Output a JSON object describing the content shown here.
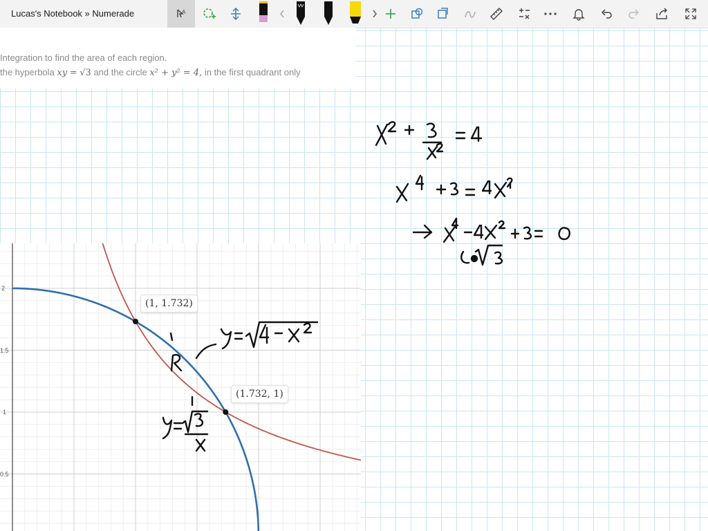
{
  "app": {
    "title": "Lucas's Notebook » Numerade"
  },
  "toolbar": {
    "buttons": [
      "lasso-select",
      "add-shape",
      "insert-space",
      "pen-black-pink",
      "pen-black-1",
      "pen-black-2",
      "pen-black-3",
      "highlighter-yellow",
      "more-pens",
      "add-pen",
      "shapes",
      "rotate-object",
      "ink-to-math",
      "ruler",
      "math",
      "more",
      "notifications",
      "undo",
      "redo",
      "share",
      "fullscreen"
    ],
    "accent": "#6b3fa0"
  },
  "problem": {
    "line1": "Integration to find the area of each region.",
    "line2_prefix": "the hyperbola",
    "eq1_lhs": "xy",
    "eq1_rhs": "√3",
    "line2_mid": "and the circle",
    "eq2": "x² + y² = 4,",
    "line2_suffix": "in the first quadrant only"
  },
  "graph": {
    "y_ticks": [
      "2",
      "1.5",
      "1",
      "0.5"
    ],
    "point1": "(1, 1.732)",
    "point2": "(1.732, 1)",
    "colors": {
      "circle": "#2f6fa8",
      "hyperbola": "#c2554a"
    }
  },
  "chart_data": {
    "type": "line",
    "series": [
      {
        "name": "",
        "function": "y = sqrt(4 - x^2)",
        "color": "#2f6fa8"
      },
      {
        "name": "",
        "function": "y = sqrt(3) / x",
        "color": "#c2554a"
      }
    ],
    "points": [
      {
        "x": 1,
        "y": 1.732,
        "label": "(1, 1.732)"
      },
      {
        "x": 1.732,
        "y": 1,
        "label": "(1.732, 1)"
      }
    ],
    "y_tick_labels": [
      "2",
      "1.5",
      "1",
      "0.5"
    ],
    "grid": true
  }
}
